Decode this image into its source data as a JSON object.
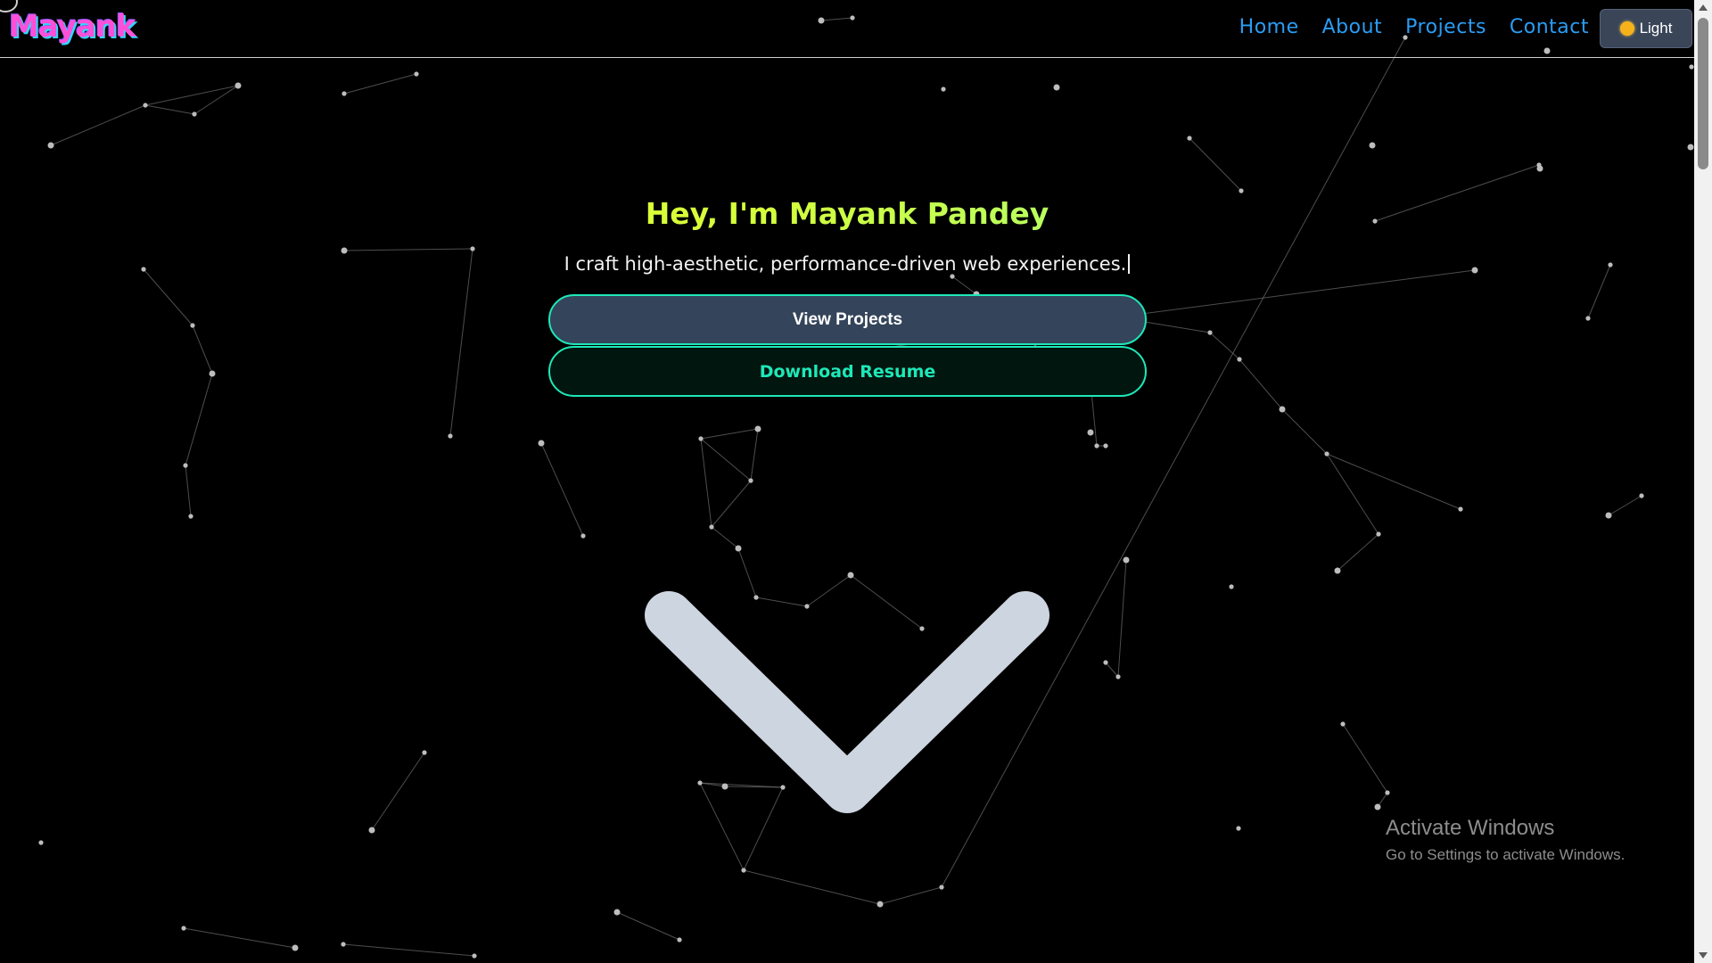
{
  "header": {
    "logo": "Mayank",
    "nav": [
      "Home",
      "About",
      "Projects",
      "Contact"
    ],
    "theme_button": {
      "label": "Light",
      "icon": "sun-icon"
    }
  },
  "hero": {
    "title": "Hey, I'm Mayank Pandey",
    "subtitle": "I craft high-aesthetic, performance-driven web experiences.",
    "primary_button": "View Projects",
    "secondary_button": "Download Resume",
    "scroll_icon": "chevron-down-icon"
  },
  "watermark": {
    "title": "Activate Windows",
    "subtitle": "Go to Settings to activate Windows."
  },
  "colors": {
    "background": "#000000",
    "nav_link": "#2a9df4",
    "accent": "#1ee8b8",
    "logo_pink": "#ff4fd8",
    "logo_cyan": "#31d6ff",
    "title_gradient_start": "#f6ff29",
    "title_gradient_end": "#7dffb0",
    "chevron": "#cdd5e0"
  }
}
